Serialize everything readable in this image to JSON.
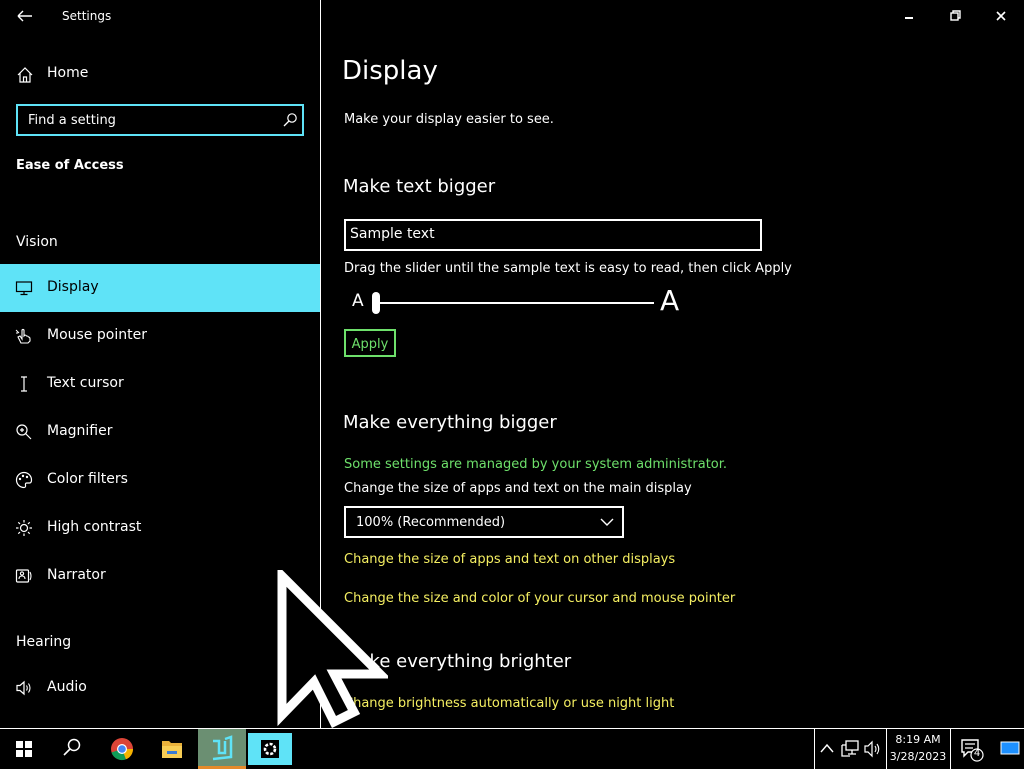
{
  "window": {
    "title": "Settings"
  },
  "sidebar": {
    "home_label": "Home",
    "search_placeholder": "Find a setting",
    "category": "Ease of Access",
    "sections": {
      "vision": "Vision",
      "hearing": "Hearing"
    },
    "items": [
      {
        "label": "Display",
        "icon": "monitor-icon",
        "selected": true
      },
      {
        "label": "Mouse pointer",
        "icon": "mouse-pointer-icon",
        "selected": false
      },
      {
        "label": "Text cursor",
        "icon": "text-cursor-icon",
        "selected": false
      },
      {
        "label": "Magnifier",
        "icon": "magnifier-icon",
        "selected": false
      },
      {
        "label": "Color filters",
        "icon": "palette-icon",
        "selected": false
      },
      {
        "label": "High contrast",
        "icon": "sun-icon",
        "selected": false
      },
      {
        "label": "Narrator",
        "icon": "narrator-icon",
        "selected": false
      },
      {
        "label": "Audio",
        "icon": "speaker-icon",
        "selected": false
      }
    ]
  },
  "main": {
    "title": "Display",
    "subtitle": "Make your display easier to see.",
    "text_bigger": {
      "heading": "Make text bigger",
      "sample_text": "Sample text",
      "instructions": "Drag the slider until the sample text is easy to read, then click Apply",
      "slider_min_label": "A",
      "slider_max_label": "A",
      "slider_value_fraction": 0.0,
      "apply_label": "Apply"
    },
    "everything_bigger": {
      "heading": "Make everything bigger",
      "admin_note": "Some settings are managed by your system administrator.",
      "select_label": "Change the size of apps and text on the main display",
      "select_value": "100% (Recommended)",
      "link_other_displays": "Change the size of apps and text on other displays",
      "link_cursor": "Change the size and color of your cursor and mouse pointer"
    },
    "everything_brighter": {
      "heading": "Make everything brighter",
      "link_brightness": "Change brightness automatically or use night light"
    }
  },
  "taskbar": {
    "apps": [
      "start-icon",
      "search-icon",
      "chrome-icon",
      "file-explorer-icon",
      "app-icon",
      "settings-gear-icon"
    ],
    "clock_time": "8:19 AM",
    "clock_date": "3/28/2023",
    "notification_count": "4"
  },
  "colors": {
    "accent": "#5fe3f7",
    "link": "#f5ef62",
    "green": "#6ee06b",
    "background": "#000000",
    "text": "#ffffff"
  }
}
